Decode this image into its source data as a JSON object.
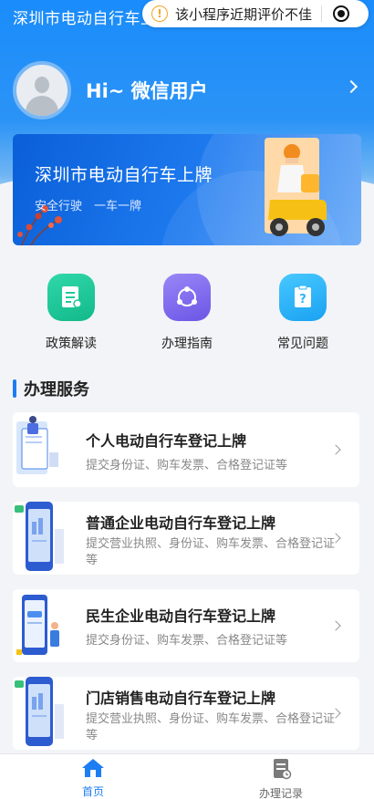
{
  "header": {
    "title": "深圳市电动自行车上牌",
    "capsule_notice": "该小程序近期评价不佳",
    "capsule_warn_symbol": "!"
  },
  "user": {
    "greeting": "Hi~ 微信用户"
  },
  "banner": {
    "title": "深圳市电动自行车上牌",
    "subtitle": "安全行驶　一车一牌"
  },
  "quick_actions": [
    {
      "label": "政策解读",
      "icon": "document-icon",
      "color": "#1ec99a"
    },
    {
      "label": "办理指南",
      "icon": "share-nodes-icon",
      "color": "#7f6cf0"
    },
    {
      "label": "常见问题",
      "icon": "question-clipboard-icon",
      "color": "#2bb6f9"
    }
  ],
  "section": {
    "title": "办理服务"
  },
  "services": [
    {
      "title": "个人电动自行车登记上牌",
      "desc": "提交身份证、购车发票、合格登记证等"
    },
    {
      "title": "普通企业电动自行车登记上牌",
      "desc": "提交营业执照、身份证、购车发票、合格登记证等"
    },
    {
      "title": "民生企业电动自行车登记上牌",
      "desc": "提交身份证、购车发票、合格登记证等"
    },
    {
      "title": "门店销售电动自行车登记上牌",
      "desc": "提交营业执照、身份证、购车发票、合格登记证等"
    }
  ],
  "tabbar": {
    "home": "首页",
    "records": "办理记录",
    "active_color": "#1d7df2",
    "inactive_color": "#666666"
  }
}
